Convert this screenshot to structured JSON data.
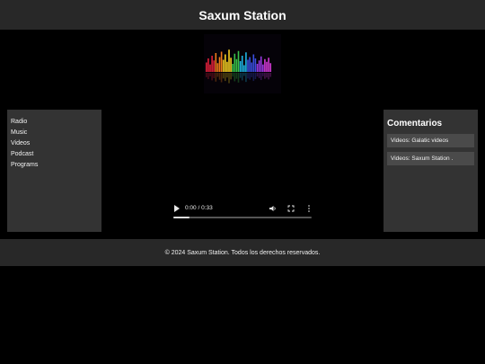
{
  "header": {
    "title": "Saxum Station"
  },
  "logo": {
    "icon": "equalizer-logo-icon",
    "bar_colors": [
      "#e0203a",
      "#f07a1a",
      "#f6d021",
      "#38c24a",
      "#1fb6e6",
      "#3a4fe0",
      "#9a3ae6",
      "#d43ad6"
    ]
  },
  "sidebar": {
    "items": [
      {
        "label": "Radio"
      },
      {
        "label": "Music"
      },
      {
        "label": "Videos"
      },
      {
        "label": "Podcast"
      },
      {
        "label": "Programs"
      }
    ]
  },
  "comments": {
    "title": "Comentarios",
    "items": [
      {
        "text": "Videos: Galatic videos"
      },
      {
        "text": "Videos: Saxum Station ."
      }
    ]
  },
  "player": {
    "time": "0:00 / 0:33",
    "progress_fraction": 0.12,
    "icons": [
      "play-icon",
      "volume-icon",
      "fullscreen-icon",
      "more-options-icon"
    ]
  },
  "footer": {
    "text": "© 2024 Saxum Station. Todos los derechos reservados."
  },
  "colors": {
    "background": "#000000",
    "bar": "#282828",
    "panel": "#333333",
    "comment_item": "#4a4a4a"
  }
}
